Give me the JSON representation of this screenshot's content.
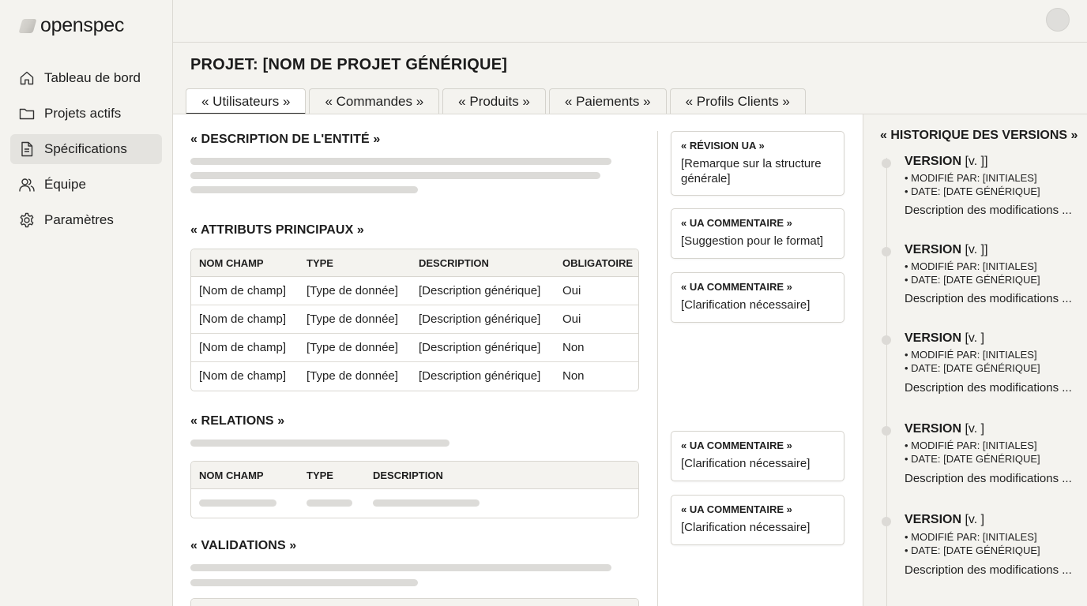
{
  "app": {
    "name": "openspec"
  },
  "sidebar": {
    "items": [
      {
        "label": "Tableau de bord",
        "icon": "home-icon",
        "active": false
      },
      {
        "label": "Projets actifs",
        "icon": "folder-icon",
        "active": false
      },
      {
        "label": "Spécifications",
        "icon": "document-icon",
        "active": true
      },
      {
        "label": "Équipe",
        "icon": "users-icon",
        "active": false
      },
      {
        "label": "Paramètres",
        "icon": "gear-icon",
        "active": false
      }
    ]
  },
  "project": {
    "title": "PROJET: [NOM DE PROJET GÉNÉRIQUE]"
  },
  "tabs": [
    {
      "label": "« Utilisateurs »",
      "active": true
    },
    {
      "label": "« Commandes »",
      "active": false
    },
    {
      "label": "« Produits »",
      "active": false
    },
    {
      "label": "« Paiements »",
      "active": false
    },
    {
      "label": "« Profils Clients »",
      "active": false
    }
  ],
  "sections": {
    "description": "« DESCRIPTION DE L'ENTITÉ »",
    "attributes": "« ATTRIBUTS PRINCIPAUX »",
    "relations": "« RELATIONS »",
    "validations": "« VALIDATIONS »"
  },
  "attributes_table": {
    "headers": [
      "NOM CHAMP",
      "TYPE",
      "DESCRIPTION",
      "OBLIGATOIRE"
    ],
    "rows": [
      [
        "[Nom de champ]",
        "[Type de donnée]",
        "[Description générique]",
        "Oui"
      ],
      [
        "[Nom de champ]",
        "[Type de donnée]",
        "[Description générique]",
        "Oui"
      ],
      [
        "[Nom de champ]",
        "[Type de donnée]",
        "[Description générique]",
        "Non"
      ],
      [
        "[Nom de champ]",
        "[Type de donnée]",
        "[Description générique]",
        "Non"
      ]
    ]
  },
  "relations_table": {
    "headers": [
      "NOM CHAMP",
      "TYPE",
      "DESCRIPTION"
    ]
  },
  "comments": [
    {
      "title": "« RÉVISION UA »",
      "text": "[Remarque sur la structure générale]"
    },
    {
      "title": "« UA COMMENTAIRE »",
      "text": "[Suggestion pour le format]"
    },
    {
      "title": "« UA COMMENTAIRE »",
      "text": "[Clarification nécessaire]"
    },
    {
      "title": "« UA COMMENTAIRE »",
      "text": "[Clarification nécessaire]"
    },
    {
      "title": "« UA COMMENTAIRE »",
      "text": "[Clarification nécessaire]"
    }
  ],
  "history": {
    "title": "« HISTORIQUE DES VERSIONS »",
    "items": [
      {
        "label": "VERSION",
        "version": "[v. ]]",
        "modified_by": "• MODIFIÉ PAR: [INITIALES]",
        "date": "• DATE: [DATE GÉNÉRIQUE]",
        "description": "Description des modifications ..."
      },
      {
        "label": "VERSION",
        "version": "[v. ]]",
        "modified_by": "• MODIFIÉ PAR: [INITIALES]",
        "date": "• DATE: [DATE GÉNÉRIQUE]",
        "description": "Description des modifications ..."
      },
      {
        "label": "VERSION",
        "version": "[v. ]",
        "modified_by": "• MODIFIÉ PAR: [INITIALES]",
        "date": "• DATE: [DATE GÉNÉRIQUE]",
        "description": "Description des modifications ..."
      },
      {
        "label": "VERSION",
        "version": "[v. ]",
        "modified_by": "• MODIFIÉ PAR: [INITIALES]",
        "date": "• DATE: [DATE GÉNÉRIQUE]",
        "description": "Description des modifications ..."
      },
      {
        "label": "VERSION",
        "version": "[v. ]",
        "modified_by": "• MODIFIÉ PAR: [INITIALES]",
        "date": "• DATE: [DATE GÉNÉRIQUE]",
        "description": "Description des modifications ..."
      }
    ]
  }
}
